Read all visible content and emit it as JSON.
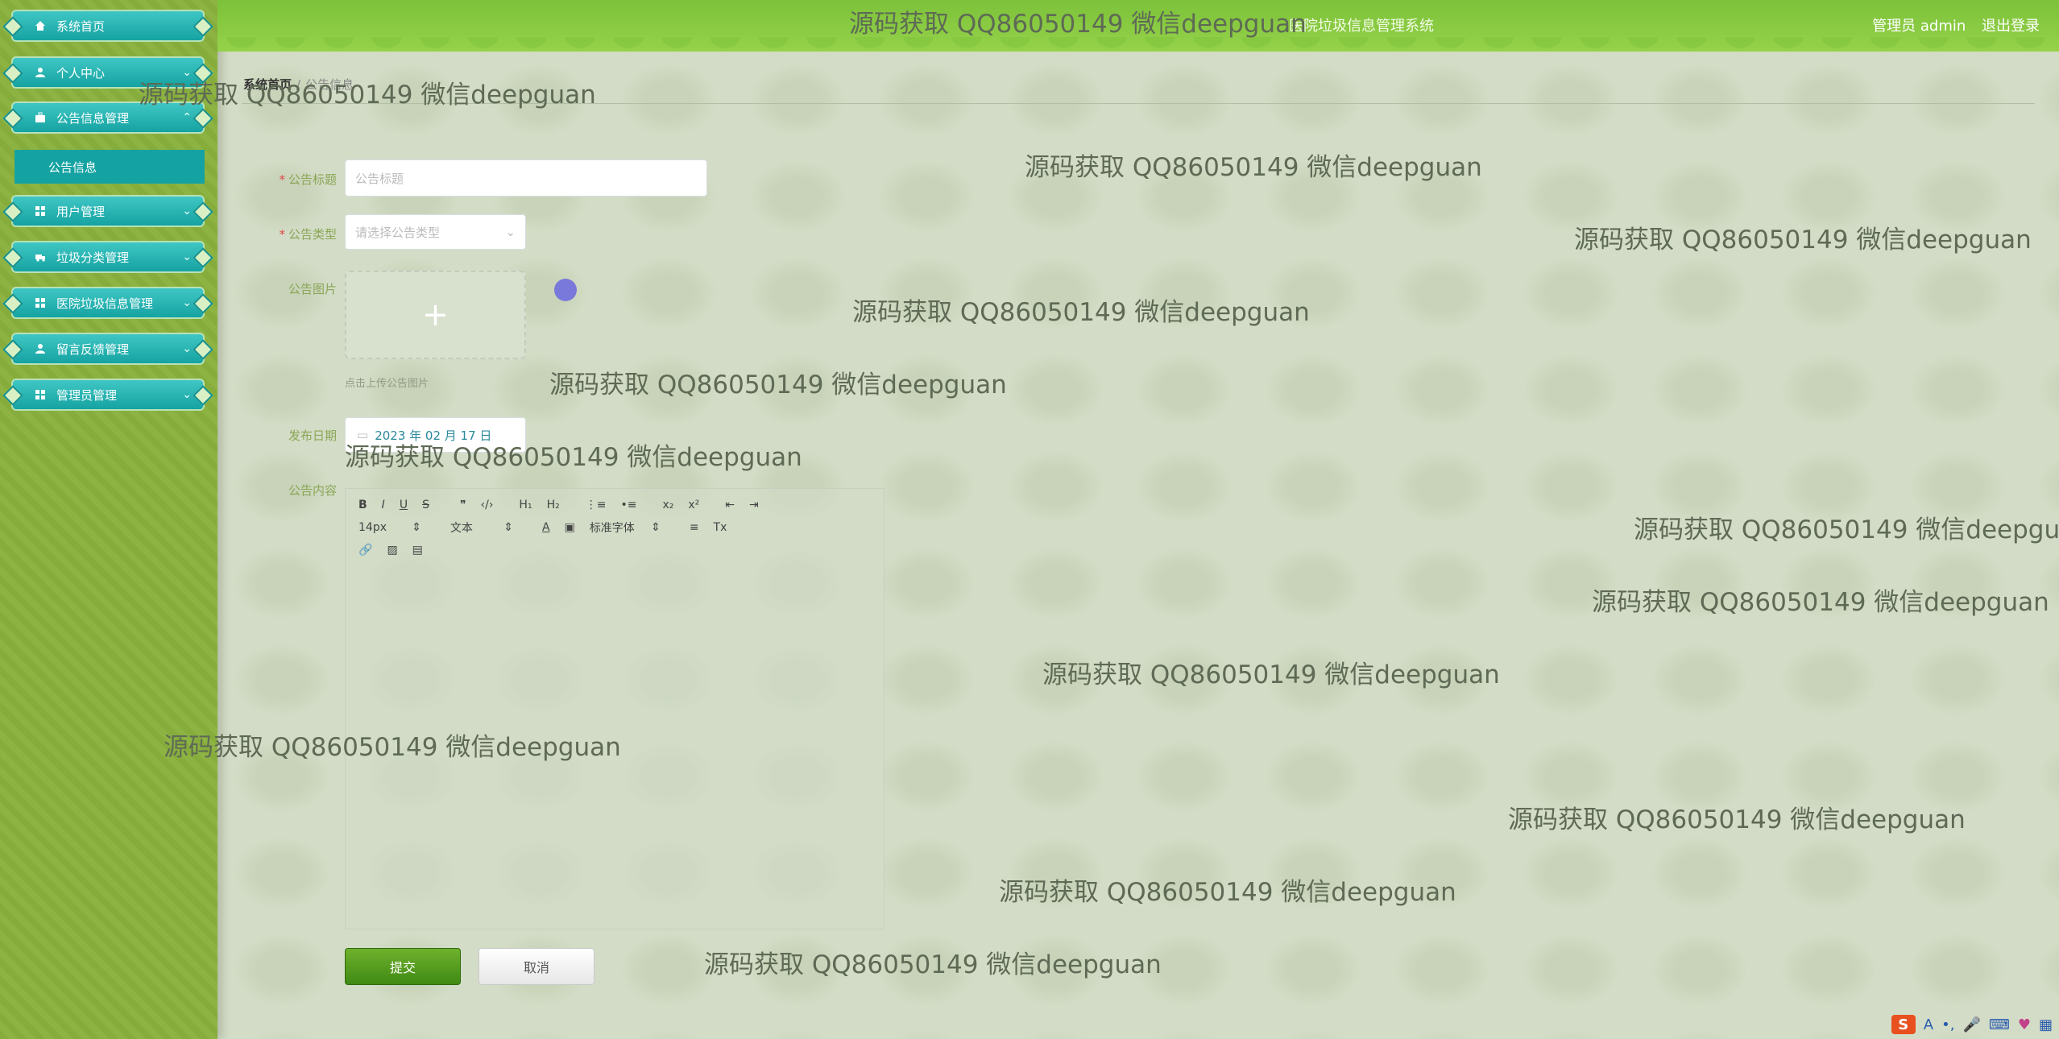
{
  "header": {
    "site_title": "医院垃圾信息管理系统",
    "role": "管理员 admin",
    "logout": "退出登录"
  },
  "sidebar": {
    "items": [
      {
        "label": "系统首页",
        "icon": "home-icon"
      },
      {
        "label": "个人中心",
        "icon": "user-icon"
      },
      {
        "label": "公告信息管理",
        "icon": "briefcase-icon"
      },
      {
        "label": "用户管理",
        "icon": "grid-icon"
      },
      {
        "label": "垃圾分类管理",
        "icon": "truck-icon"
      },
      {
        "label": "医院垃圾信息管理",
        "icon": "grid-icon"
      },
      {
        "label": "留言反馈管理",
        "icon": "user-icon"
      },
      {
        "label": "管理员管理",
        "icon": "grid-icon"
      }
    ],
    "submenu": {
      "label": "公告信息"
    }
  },
  "breadcrumb": {
    "home": "系统首页",
    "current": "公告信息"
  },
  "form": {
    "title_label": "公告标题",
    "title_placeholder": "公告标题",
    "type_label": "公告类型",
    "type_placeholder": "请选择公告类型",
    "image_label": "公告图片",
    "upload_hint": "点击上传公告图片",
    "date_label": "发布日期",
    "date_value": "2023 年 02 月 17 日",
    "content_label": "公告内容",
    "editor": {
      "font_size": "14px",
      "block_type": "文本",
      "font_family": "标准字体"
    },
    "submit": "提交",
    "cancel": "取消"
  },
  "watermark": "源码获取 QQ86050149 微信deepguan"
}
